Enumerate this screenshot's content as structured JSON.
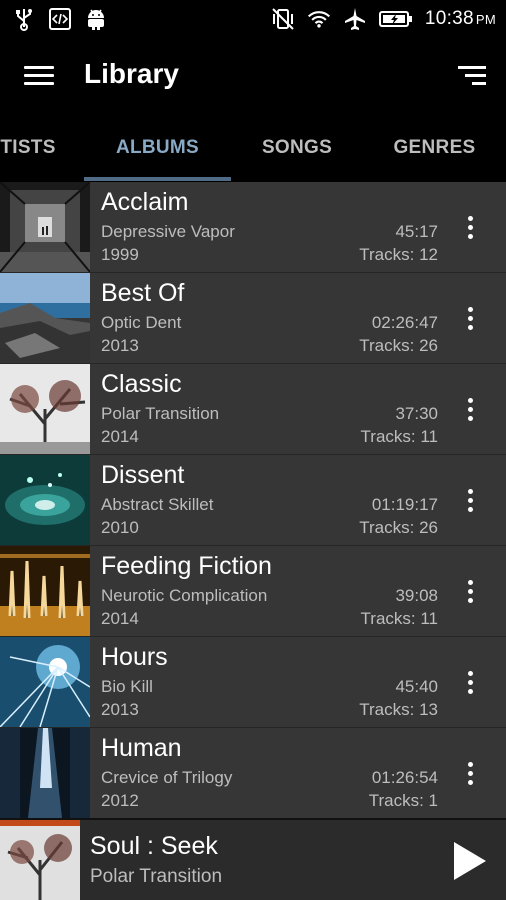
{
  "status_bar": {
    "time": "10:38",
    "ampm": "PM",
    "icons": [
      "usb-icon",
      "code-icon",
      "android-icon",
      "vibrate-off-icon",
      "wifi-icon",
      "airplane-icon",
      "battery-charging-icon"
    ]
  },
  "app_bar": {
    "title": "Library",
    "menu_icon": "hamburger-icon",
    "sort_icon": "sort-icon"
  },
  "tabs": [
    {
      "label": "TISTS",
      "active": false
    },
    {
      "label": "ALBUMS",
      "active": true
    },
    {
      "label": "SONGS",
      "active": false
    },
    {
      "label": "GENRES",
      "active": false
    }
  ],
  "albums": [
    {
      "title": "Acclaim",
      "artist": "Depressive Vapor",
      "year": "1999",
      "duration": "45:17",
      "tracks": "Tracks: 12"
    },
    {
      "title": "Best Of",
      "artist": "Optic Dent",
      "year": "2013",
      "duration": "02:26:47",
      "tracks": "Tracks: 26"
    },
    {
      "title": "Classic",
      "artist": "Polar Transition",
      "year": "2014",
      "duration": "37:30",
      "tracks": "Tracks: 11"
    },
    {
      "title": "Dissent",
      "artist": "Abstract Skillet",
      "year": "2010",
      "duration": "01:19:17",
      "tracks": "Tracks: 26"
    },
    {
      "title": "Feeding Fiction",
      "artist": "Neurotic Complication",
      "year": "2014",
      "duration": "39:08",
      "tracks": "Tracks: 11"
    },
    {
      "title": "Hours",
      "artist": "Bio Kill",
      "year": "2013",
      "duration": "45:40",
      "tracks": "Tracks: 13"
    },
    {
      "title": "Human",
      "artist": "Crevice of Trilogy",
      "year": "2012",
      "duration": "01:26:54",
      "tracks": "Tracks: 1"
    }
  ],
  "now_playing": {
    "title": "Soul : Seek",
    "artist": "Polar Transition",
    "play_icon": "play-icon"
  },
  "colors": {
    "tab_active": "#89a9c4",
    "tab_indicator": "#4f6b85",
    "list_bg": "#363636"
  }
}
